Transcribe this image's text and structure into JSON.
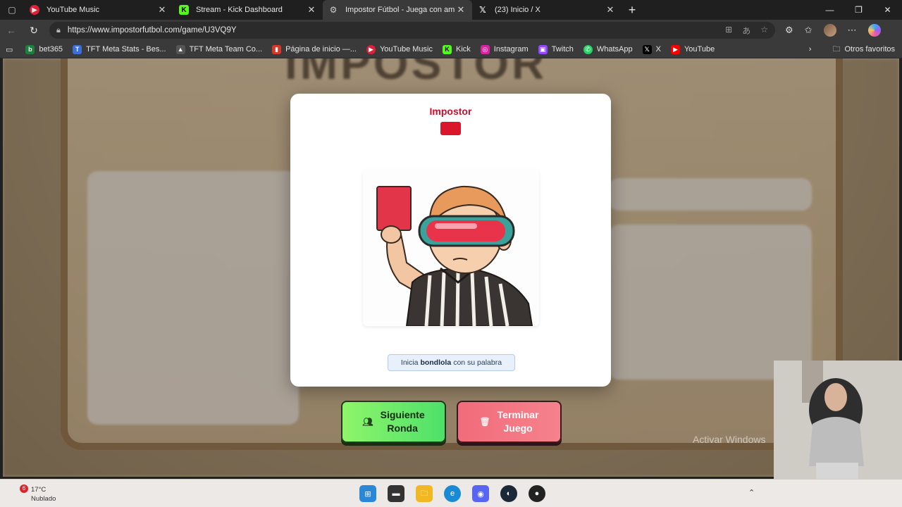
{
  "browser": {
    "tabs": [
      {
        "title": "YouTube Music",
        "favicon": "youtube-music-icon",
        "active": false
      },
      {
        "title": "Stream - Kick Dashboard",
        "favicon": "kick-icon",
        "active": false
      },
      {
        "title": "Impostor Fútbol - Juega con amig",
        "favicon": "gear-icon",
        "active": true
      },
      {
        "title": "(23) Inicio / X",
        "favicon": "x-icon",
        "active": false
      }
    ],
    "url": "https://www.impostorfutbol.com/game/U3VQ9Y",
    "bookmarks": [
      {
        "label": "bet365",
        "icon": "bet365-icon",
        "color": "#1c7f3c"
      },
      {
        "label": "TFT Meta Stats - Bes...",
        "icon": "tft-icon",
        "color": "#3a6fd8"
      },
      {
        "label": "TFT Meta Team Co...",
        "icon": "tft-team-icon",
        "color": "#555555"
      },
      {
        "label": "Página de inicio —...",
        "icon": "bookmark-icon",
        "color": "#d43a2a"
      },
      {
        "label": "YouTube Music",
        "icon": "youtube-music-icon",
        "color": "#e0203a"
      },
      {
        "label": "Kick",
        "icon": "kick-icon",
        "color": "#53fc18"
      },
      {
        "label": "Instagram",
        "icon": "instagram-icon",
        "color": "#d6249f"
      },
      {
        "label": "Twitch",
        "icon": "twitch-icon",
        "color": "#9146ff"
      },
      {
        "label": "WhatsApp",
        "icon": "whatsapp-icon",
        "color": "#25d366"
      },
      {
        "label": "X",
        "icon": "x-icon",
        "color": "#000000"
      },
      {
        "label": "YouTube",
        "icon": "youtube-icon",
        "color": "#ff0000"
      }
    ],
    "other_favorites": "Otros favoritos"
  },
  "modal": {
    "title": "Impostor",
    "hint_prefix": "Inicia",
    "hint_name": "bondlola",
    "hint_suffix": "con su palabra"
  },
  "buttons": {
    "next_line1": "Siguiente",
    "next_line2": "Ronda",
    "end_line1": "Terminar",
    "end_line2": "Juego"
  },
  "watermark": "Activar Windows",
  "taskbar": {
    "notification_count": "6",
    "temperature": "17°C",
    "condition": "Nublado"
  },
  "colors": {
    "accent_red": "#c8102e",
    "next_green": "#4ee06a",
    "end_red": "#f26b7b"
  }
}
